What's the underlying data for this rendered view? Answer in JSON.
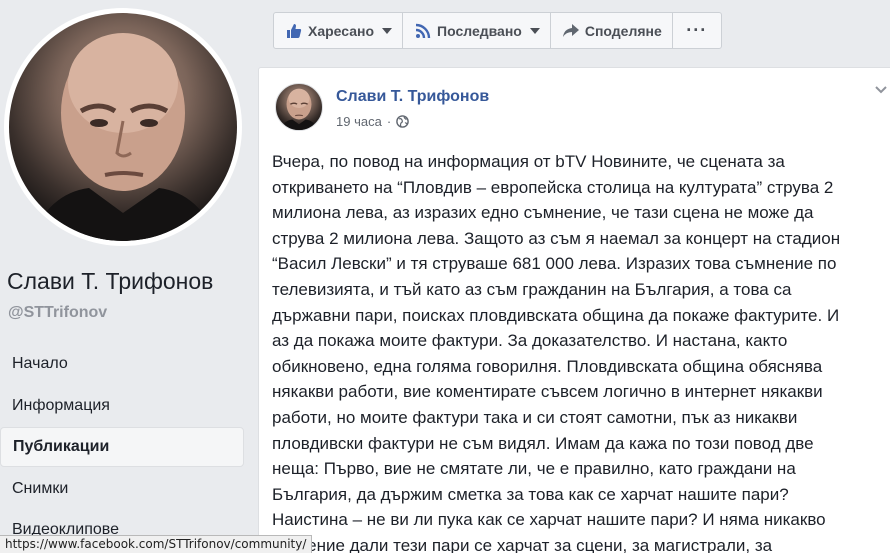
{
  "profile": {
    "name": "Слави Т. Трифонов",
    "handle": "@STTrifonov"
  },
  "nav": {
    "items": [
      {
        "label": "Начало"
      },
      {
        "label": "Информация"
      },
      {
        "label": "Публикации"
      },
      {
        "label": "Снимки"
      },
      {
        "label": "Видеоклипове"
      }
    ]
  },
  "actions": {
    "like": "Харесано",
    "follow": "Последвано",
    "share": "Споделяне",
    "more": "···"
  },
  "post": {
    "author": "Слави Т. Трифонов",
    "time": "19 часа",
    "dot": "·",
    "text": "Вчера, по повод на информация от bTV Новините, че сцената за\nоткриването на “Пловдив – европейска столица на културата” струва 2\nмилиона лева, аз изразих едно съмнение, че тази сцена не може да\nструва 2 милиона лева. Защото аз съм я наемал за концерт на стадион\n“Васил Левски” и тя струваше 681 000 лева. Изразих това съмнение по\nтелевизията, и тъй като аз съм гражданин на България, а това са\nдържавни пари, поисках пловдивската община да покаже фактурите. И\nаз да покажа моите фактури. За доказателство. И настана, както\nобикновено, една голяма говорилня. Пловдивската община обяснява\nнякакви работи, вие коментирате съвсем логично в интернет някакви\nработи, но моите фактури така и си стоят самотни, пък аз никакви\nпловдивски фактури не съм видял. Имам да кажа по този повод две\nнеща: Първо, вие не смятате ли, че е правилно, като граждани на\nБългария, да държим сметка за това как се харчат нашите пари?\nНаистина – не ви ли пука как се харчат нашите пари? И няма никакво\nзначение дали тези пари се харчат за сцени, за магистрали, за"
  },
  "status_bar": {
    "url": "https://www.facebook.com/STTrifonov/community/"
  },
  "colors": {
    "link": "#365899",
    "background": "#e9ebee",
    "meta": "#616770"
  }
}
